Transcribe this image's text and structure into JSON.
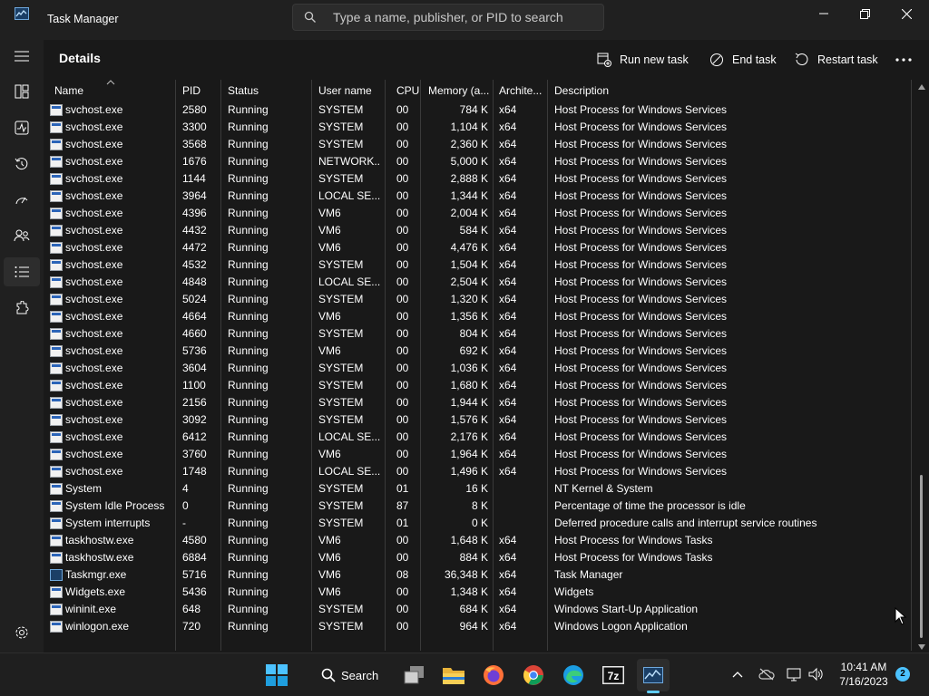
{
  "window": {
    "title": "Task Manager"
  },
  "search": {
    "placeholder": "Type a name, publisher, or PID to search"
  },
  "page": {
    "title": "Details"
  },
  "toolbar": {
    "run_new_task": "Run new task",
    "end_task": "End task",
    "restart_task": "Restart task"
  },
  "nav": {
    "items": [
      "menu-icon",
      "processes-icon",
      "performance-icon",
      "app-history-icon",
      "startup-apps-icon",
      "users-icon",
      "details-icon",
      "services-icon"
    ],
    "active": "details-icon",
    "settings": "settings-icon"
  },
  "columns": [
    "Name",
    "PID",
    "Status",
    "User name",
    "CPU",
    "Memory (a...",
    "Archite...",
    "Description"
  ],
  "rows": [
    {
      "name": "svchost.exe",
      "pid": "2580",
      "status": "Running",
      "user": "SYSTEM",
      "cpu": "00",
      "mem": "784 K",
      "arch": "x64",
      "desc": "Host Process for Windows Services",
      "icon": "service"
    },
    {
      "name": "svchost.exe",
      "pid": "3300",
      "status": "Running",
      "user": "SYSTEM",
      "cpu": "00",
      "mem": "1,104 K",
      "arch": "x64",
      "desc": "Host Process for Windows Services",
      "icon": "service"
    },
    {
      "name": "svchost.exe",
      "pid": "3568",
      "status": "Running",
      "user": "SYSTEM",
      "cpu": "00",
      "mem": "2,360 K",
      "arch": "x64",
      "desc": "Host Process for Windows Services",
      "icon": "service"
    },
    {
      "name": "svchost.exe",
      "pid": "1676",
      "status": "Running",
      "user": "NETWORK...",
      "cpu": "00",
      "mem": "5,000 K",
      "arch": "x64",
      "desc": "Host Process for Windows Services",
      "icon": "service"
    },
    {
      "name": "svchost.exe",
      "pid": "1144",
      "status": "Running",
      "user": "SYSTEM",
      "cpu": "00",
      "mem": "2,888 K",
      "arch": "x64",
      "desc": "Host Process for Windows Services",
      "icon": "service"
    },
    {
      "name": "svchost.exe",
      "pid": "3964",
      "status": "Running",
      "user": "LOCAL SE...",
      "cpu": "00",
      "mem": "1,344 K",
      "arch": "x64",
      "desc": "Host Process for Windows Services",
      "icon": "service"
    },
    {
      "name": "svchost.exe",
      "pid": "4396",
      "status": "Running",
      "user": "VM6",
      "cpu": "00",
      "mem": "2,004 K",
      "arch": "x64",
      "desc": "Host Process for Windows Services",
      "icon": "service"
    },
    {
      "name": "svchost.exe",
      "pid": "4432",
      "status": "Running",
      "user": "VM6",
      "cpu": "00",
      "mem": "584 K",
      "arch": "x64",
      "desc": "Host Process for Windows Services",
      "icon": "service"
    },
    {
      "name": "svchost.exe",
      "pid": "4472",
      "status": "Running",
      "user": "VM6",
      "cpu": "00",
      "mem": "4,476 K",
      "arch": "x64",
      "desc": "Host Process for Windows Services",
      "icon": "service"
    },
    {
      "name": "svchost.exe",
      "pid": "4532",
      "status": "Running",
      "user": "SYSTEM",
      "cpu": "00",
      "mem": "1,504 K",
      "arch": "x64",
      "desc": "Host Process for Windows Services",
      "icon": "service"
    },
    {
      "name": "svchost.exe",
      "pid": "4848",
      "status": "Running",
      "user": "LOCAL SE...",
      "cpu": "00",
      "mem": "2,504 K",
      "arch": "x64",
      "desc": "Host Process for Windows Services",
      "icon": "service"
    },
    {
      "name": "svchost.exe",
      "pid": "5024",
      "status": "Running",
      "user": "SYSTEM",
      "cpu": "00",
      "mem": "1,320 K",
      "arch": "x64",
      "desc": "Host Process for Windows Services",
      "icon": "service"
    },
    {
      "name": "svchost.exe",
      "pid": "4664",
      "status": "Running",
      "user": "VM6",
      "cpu": "00",
      "mem": "1,356 K",
      "arch": "x64",
      "desc": "Host Process for Windows Services",
      "icon": "service"
    },
    {
      "name": "svchost.exe",
      "pid": "4660",
      "status": "Running",
      "user": "SYSTEM",
      "cpu": "00",
      "mem": "804 K",
      "arch": "x64",
      "desc": "Host Process for Windows Services",
      "icon": "service"
    },
    {
      "name": "svchost.exe",
      "pid": "5736",
      "status": "Running",
      "user": "VM6",
      "cpu": "00",
      "mem": "692 K",
      "arch": "x64",
      "desc": "Host Process for Windows Services",
      "icon": "service"
    },
    {
      "name": "svchost.exe",
      "pid": "3604",
      "status": "Running",
      "user": "SYSTEM",
      "cpu": "00",
      "mem": "1,036 K",
      "arch": "x64",
      "desc": "Host Process for Windows Services",
      "icon": "service"
    },
    {
      "name": "svchost.exe",
      "pid": "1100",
      "status": "Running",
      "user": "SYSTEM",
      "cpu": "00",
      "mem": "1,680 K",
      "arch": "x64",
      "desc": "Host Process for Windows Services",
      "icon": "service"
    },
    {
      "name": "svchost.exe",
      "pid": "2156",
      "status": "Running",
      "user": "SYSTEM",
      "cpu": "00",
      "mem": "1,944 K",
      "arch": "x64",
      "desc": "Host Process for Windows Services",
      "icon": "service"
    },
    {
      "name": "svchost.exe",
      "pid": "3092",
      "status": "Running",
      "user": "SYSTEM",
      "cpu": "00",
      "mem": "1,576 K",
      "arch": "x64",
      "desc": "Host Process for Windows Services",
      "icon": "service"
    },
    {
      "name": "svchost.exe",
      "pid": "6412",
      "status": "Running",
      "user": "LOCAL SE...",
      "cpu": "00",
      "mem": "2,176 K",
      "arch": "x64",
      "desc": "Host Process for Windows Services",
      "icon": "service"
    },
    {
      "name": "svchost.exe",
      "pid": "3760",
      "status": "Running",
      "user": "VM6",
      "cpu": "00",
      "mem": "1,964 K",
      "arch": "x64",
      "desc": "Host Process for Windows Services",
      "icon": "service"
    },
    {
      "name": "svchost.exe",
      "pid": "1748",
      "status": "Running",
      "user": "LOCAL SE...",
      "cpu": "00",
      "mem": "1,496 K",
      "arch": "x64",
      "desc": "Host Process for Windows Services",
      "icon": "service"
    },
    {
      "name": "System",
      "pid": "4",
      "status": "Running",
      "user": "SYSTEM",
      "cpu": "01",
      "mem": "16 K",
      "arch": "",
      "desc": "NT Kernel & System",
      "icon": "service"
    },
    {
      "name": "System Idle Process",
      "pid": "0",
      "status": "Running",
      "user": "SYSTEM",
      "cpu": "87",
      "mem": "8 K",
      "arch": "",
      "desc": "Percentage of time the processor is idle",
      "icon": "service"
    },
    {
      "name": "System interrupts",
      "pid": "-",
      "status": "Running",
      "user": "SYSTEM",
      "cpu": "01",
      "mem": "0 K",
      "arch": "",
      "desc": "Deferred procedure calls and interrupt service routines",
      "icon": "service"
    },
    {
      "name": "taskhostw.exe",
      "pid": "4580",
      "status": "Running",
      "user": "VM6",
      "cpu": "00",
      "mem": "1,648 K",
      "arch": "x64",
      "desc": "Host Process for Windows Tasks",
      "icon": "service"
    },
    {
      "name": "taskhostw.exe",
      "pid": "6884",
      "status": "Running",
      "user": "VM6",
      "cpu": "00",
      "mem": "884 K",
      "arch": "x64",
      "desc": "Host Process for Windows Tasks",
      "icon": "service"
    },
    {
      "name": "Taskmgr.exe",
      "pid": "5716",
      "status": "Running",
      "user": "VM6",
      "cpu": "08",
      "mem": "36,348 K",
      "arch": "x64",
      "desc": "Task Manager",
      "icon": "taskmgr"
    },
    {
      "name": "Widgets.exe",
      "pid": "5436",
      "status": "Running",
      "user": "VM6",
      "cpu": "00",
      "mem": "1,348 K",
      "arch": "x64",
      "desc": "Widgets",
      "icon": "service"
    },
    {
      "name": "wininit.exe",
      "pid": "648",
      "status": "Running",
      "user": "SYSTEM",
      "cpu": "00",
      "mem": "684 K",
      "arch": "x64",
      "desc": "Windows Start-Up Application",
      "icon": "service"
    },
    {
      "name": "winlogon.exe",
      "pid": "720",
      "status": "Running",
      "user": "SYSTEM",
      "cpu": "00",
      "mem": "964 K",
      "arch": "x64",
      "desc": "Windows Logon Application",
      "icon": "service"
    }
  ],
  "taskbar": {
    "search_label": "Search",
    "icons": [
      "start-icon",
      "search-icon",
      "task-view-icon",
      "file-explorer-icon",
      "firefox-icon",
      "chrome-icon",
      "edge-icon",
      "7zip-icon",
      "task-manager-icon"
    ],
    "tray": [
      "chevron-up-icon",
      "onedrive-icon",
      "network-icon",
      "volume-icon"
    ],
    "time": "10:41 AM",
    "date": "7/16/2023",
    "notifications": "2"
  },
  "colors": {
    "accent": "#60cdff",
    "background": "#191919",
    "chrome": "#202020"
  }
}
